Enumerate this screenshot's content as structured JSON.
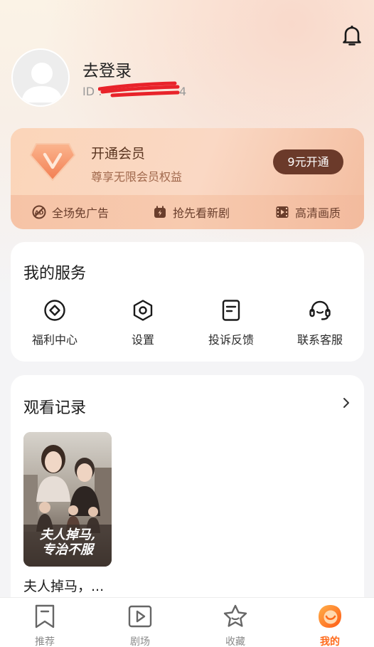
{
  "header": {
    "bell_icon": "bell-icon"
  },
  "profile": {
    "login_label": "去登录",
    "id_prefix": "ID :",
    "id_suffix": "4"
  },
  "vip": {
    "title": "开通会员",
    "subtitle": "尊享无限会员权益",
    "button": "9元开通",
    "perks": [
      {
        "icon": "no-ads-icon",
        "label": "全场免广告"
      },
      {
        "icon": "early-access-icon",
        "label": "抢先看新剧"
      },
      {
        "icon": "hd-film-icon",
        "label": "高清画质"
      }
    ],
    "accent": "#6b3a2a"
  },
  "services": {
    "title": "我的服务",
    "items": [
      {
        "icon": "diamond-circle-icon",
        "label": "福利中心"
      },
      {
        "icon": "settings-hexagon-icon",
        "label": "设置"
      },
      {
        "icon": "feedback-doc-icon",
        "label": "投诉反馈"
      },
      {
        "icon": "headset-icon",
        "label": "联系客服"
      }
    ]
  },
  "history": {
    "title": "观看记录",
    "items": [
      {
        "poster_text_line1": "夫人掉马,",
        "poster_text_line2": "专治不服",
        "caption": "夫人掉马，..."
      }
    ]
  },
  "tabbar": {
    "items": [
      {
        "icon": "bookmark-icon",
        "label": "推荐",
        "active": false
      },
      {
        "icon": "play-square-icon",
        "label": "剧场",
        "active": false
      },
      {
        "icon": "star-icon",
        "label": "收藏",
        "active": false
      },
      {
        "icon": "smile-face-icon",
        "label": "我的",
        "active": true
      }
    ],
    "active_color": "#ff6a1a"
  }
}
